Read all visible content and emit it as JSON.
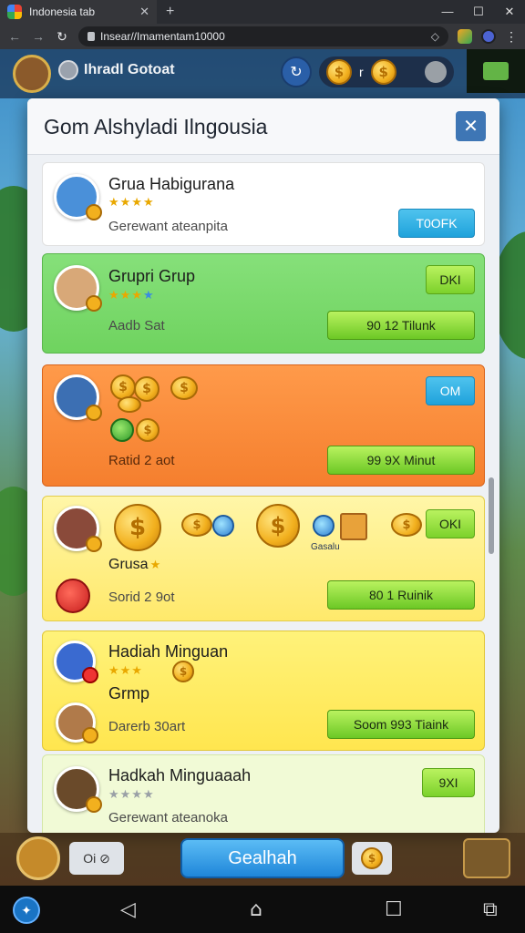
{
  "browser": {
    "tab_title": "Indonesia tab",
    "tab_close": "✕",
    "new_tab": "+",
    "win_min": "—",
    "win_max": "☐",
    "win_close": "✕",
    "url": "Insear//Imamentam10000",
    "back": "←",
    "forward": "→",
    "reload": "↻",
    "menu": "⋮",
    "ext_icon": "puzzle-icon"
  },
  "hud": {
    "player_name": "Ihradl Gotoat",
    "button_label": "↻",
    "pill_text": "r",
    "coin_symbol": "$"
  },
  "modal": {
    "title": "Gom Alshyladi Ilngousia",
    "close": "✕",
    "cards": [
      {
        "title": "Grua Habigurana",
        "stars": "★★★★",
        "sub": "Gerewant ateanpita",
        "button": "T0OFK"
      },
      {
        "title": "Grupri Grup",
        "stars": "★★★",
        "stars_blue": "★",
        "sub": "Aadb Sat",
        "button_small": "DKI",
        "button_wide": "90 12 Tilunk"
      },
      {
        "title": "",
        "sub": "Ratid 2 aot",
        "button_small": "OM",
        "button_wide": "99 9X Minut"
      },
      {
        "title": "Grusa",
        "stars": "★",
        "sub": "Sorid 2 9ot",
        "button_small": "OKI",
        "button_wide": "80 1 Ruinik",
        "label": "Gasalu"
      },
      {
        "title": "Hadiah Minguan",
        "title2": "Grmp",
        "stars": "★★★",
        "sub": "Darerb 30art",
        "button_wide": "Soom 993 Tiaink"
      },
      {
        "title": "Hadkah Minguaaah",
        "stars": "★★★★",
        "sub": "Gerewant ateanoka",
        "button_small": "9XI"
      }
    ]
  },
  "bottom_bar": {
    "chip": "Oi ⊘",
    "main_button": "Gealhah",
    "coin_symbol": "$"
  },
  "android_nav": {
    "back": "◁",
    "home": "⌂",
    "recents": "☐",
    "extra": "⧉"
  }
}
